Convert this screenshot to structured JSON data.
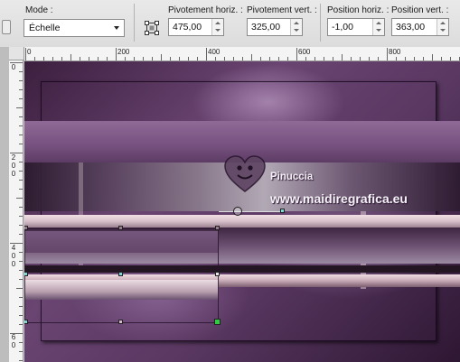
{
  "toolbar": {
    "mode_label": "Mode :",
    "mode_value": "Échelle",
    "pivot_h_label": "Pivotement horiz. :",
    "pivot_h_value": "475,00",
    "pivot_v_label": "Pivotement vert. :",
    "pivot_v_value": "325,00",
    "pos_h_label": "Position horiz. :",
    "pos_h_value": "-1,00",
    "pos_v_label": "Position vert. :",
    "pos_v_value": "363,00"
  },
  "ruler_top": {
    "labels": [
      "0",
      "200",
      "400",
      "600",
      "800"
    ]
  },
  "ruler_left": {
    "groups": [
      {
        "digits": [
          "0"
        ]
      },
      {
        "digits": [
          "2",
          "0",
          "0"
        ]
      },
      {
        "digits": [
          "4",
          "0",
          "0"
        ]
      },
      {
        "digits": [
          "6",
          "0"
        ]
      }
    ]
  },
  "watermark": {
    "line1": "Pinuccia",
    "line2": "www.maidiregrafica.eu"
  },
  "colors": {
    "canvas_dark": "#3c1f3f",
    "canvas_mid": "#6a4572",
    "highlight_pink": "#e8d2da",
    "handle_cyan": "#7fd6d8",
    "handle_green": "#2ecc40"
  }
}
